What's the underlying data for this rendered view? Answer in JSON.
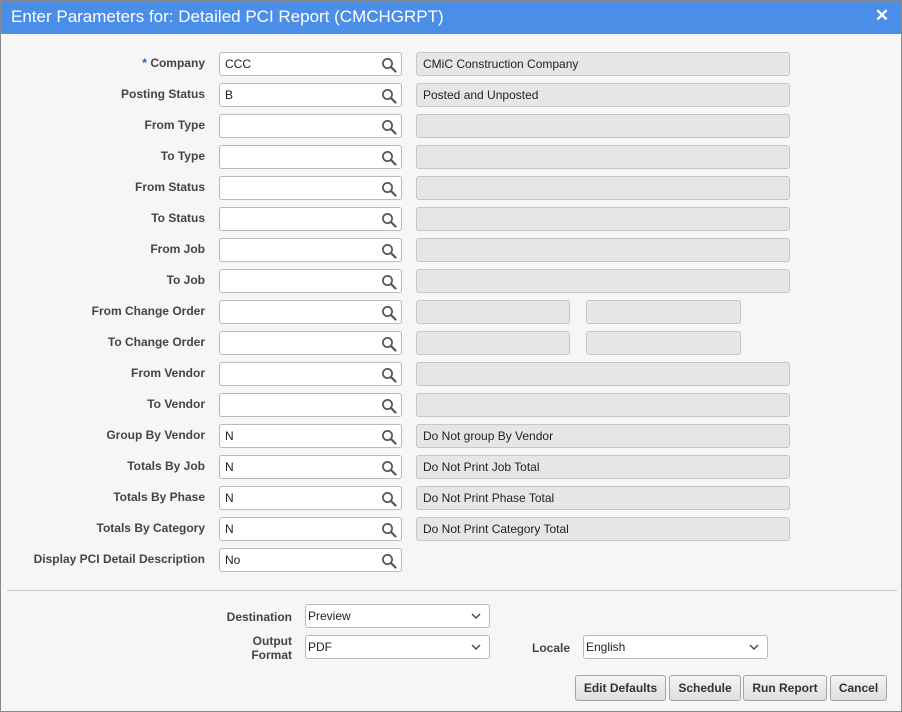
{
  "dialog": {
    "title": "Enter Parameters for: Detailed PCI Report (CMCHGRPT)",
    "close_glyph": "✕"
  },
  "colors": {
    "titlebar": "#4a8ee8",
    "required_marker": "#2d5da8",
    "readonly_field": "#e6e6e6"
  },
  "params": [
    {
      "label": "Company",
      "required": "* ",
      "value": "CCC",
      "desc": "CMiC Construction Company"
    },
    {
      "label": "Posting Status",
      "value": "B",
      "desc": "Posted and Unposted"
    },
    {
      "label": "From Type",
      "value": "",
      "desc": ""
    },
    {
      "label": "To Type",
      "value": "",
      "desc": ""
    },
    {
      "label": "From Status",
      "value": "",
      "desc": ""
    },
    {
      "label": "To Status",
      "value": "",
      "desc": ""
    },
    {
      "label": "From Job",
      "value": "",
      "desc": ""
    },
    {
      "label": "To Job",
      "value": "",
      "desc": ""
    },
    {
      "label": "From Change Order",
      "value": "",
      "desc": "",
      "desc2": ""
    },
    {
      "label": "To Change Order",
      "value": "",
      "desc": "",
      "desc2": ""
    },
    {
      "label": "From Vendor",
      "value": "",
      "desc": ""
    },
    {
      "label": "To Vendor",
      "value": "",
      "desc": ""
    },
    {
      "label": "Group By Vendor",
      "value": "N",
      "desc": "Do Not group By Vendor"
    },
    {
      "label": "Totals By Job",
      "value": "N",
      "desc": "Do Not Print Job Total"
    },
    {
      "label": "Totals By Phase",
      "value": "N",
      "desc": "Do Not Print Phase Total"
    },
    {
      "label": "Totals By Category",
      "value": "N",
      "desc": "Do Not Print Category Total"
    },
    {
      "label": "Display PCI Detail Description",
      "value": "No"
    }
  ],
  "output": {
    "destination_label": "Destination",
    "destination_value": "Preview",
    "format_label_line1": "Output",
    "format_label_line2": "Format",
    "format_value": "PDF",
    "locale_label": "Locale",
    "locale_value": "English"
  },
  "buttons": {
    "edit_defaults": "Edit Defaults",
    "schedule": "Schedule",
    "run_report": "Run Report",
    "cancel": "Cancel"
  },
  "icons": {
    "lookup": "search-icon",
    "dropdown": "chevron-down-icon",
    "close": "close-icon"
  }
}
